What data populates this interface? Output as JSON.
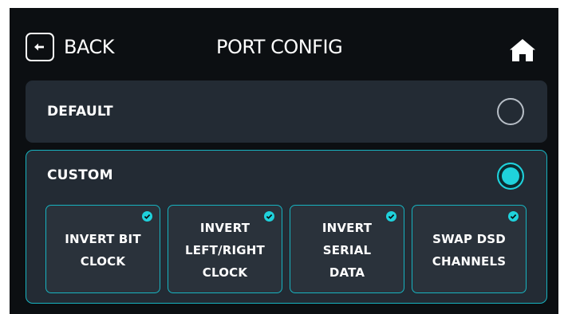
{
  "header": {
    "back_label": "BACK",
    "title": "PORT CONFIG",
    "back_icon": "arrow-left-icon",
    "home_icon": "home-icon"
  },
  "options": {
    "default": {
      "label": "DEFAULT",
      "selected": false
    },
    "custom": {
      "label": "CUSTOM",
      "selected": true,
      "toggles": [
        {
          "label": "INVERT BIT\nCLOCK",
          "checked": true
        },
        {
          "label": "INVERT\nLEFT/RIGHT\nCLOCK",
          "checked": true
        },
        {
          "label": "INVERT\nSERIAL\nDATA",
          "checked": true
        },
        {
          "label": "SWAP DSD\nCHANNELS",
          "checked": true
        }
      ]
    }
  },
  "colors": {
    "background": "#0c0f12",
    "card": "#232b34",
    "toggle": "#2a323b",
    "accent": "#1fd2dc",
    "border_accent": "#17b3c0"
  }
}
